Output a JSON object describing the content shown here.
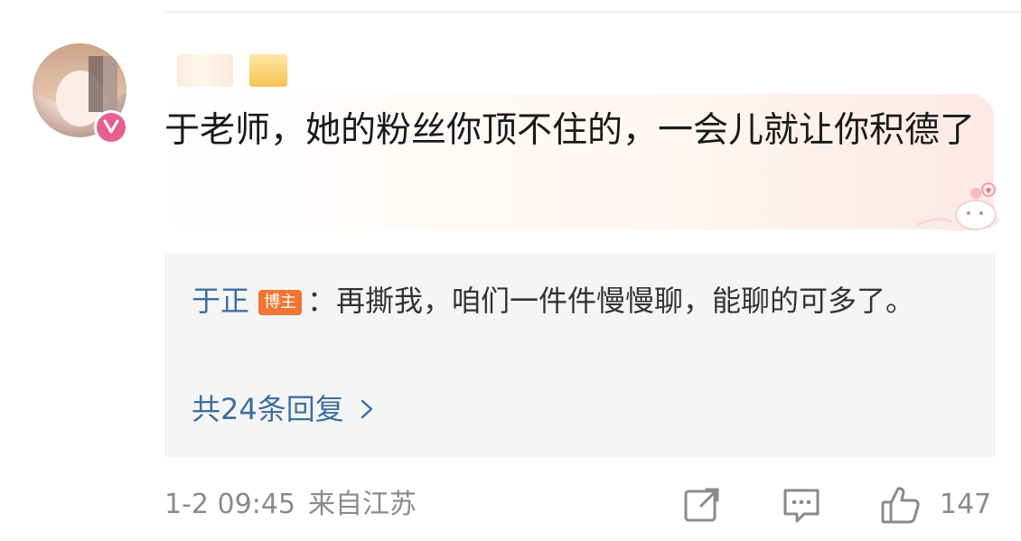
{
  "comment": {
    "text": "于老师，她的粉丝你顶不住的，一会儿就让你积德了",
    "reply": {
      "author": "于正",
      "badge": "博主",
      "separator": "：",
      "text": "再撕我，咱们一件件慢慢聊，能聊的可多了。"
    },
    "more_replies": "共24条回复",
    "timestamp": "1-2 09:45",
    "location": "来自江苏",
    "like_count": "147"
  },
  "icons": {
    "share": "share-icon",
    "comment": "comment-icon",
    "like": "thumbs-up-icon",
    "member": "member-badge-icon",
    "more": "chevron-right-icon"
  },
  "colors": {
    "link_blue": "#3c6e9f",
    "badge_orange": "#f07632",
    "meta_gray": "#8a8a8a",
    "member_pink": "#e75f8f"
  }
}
